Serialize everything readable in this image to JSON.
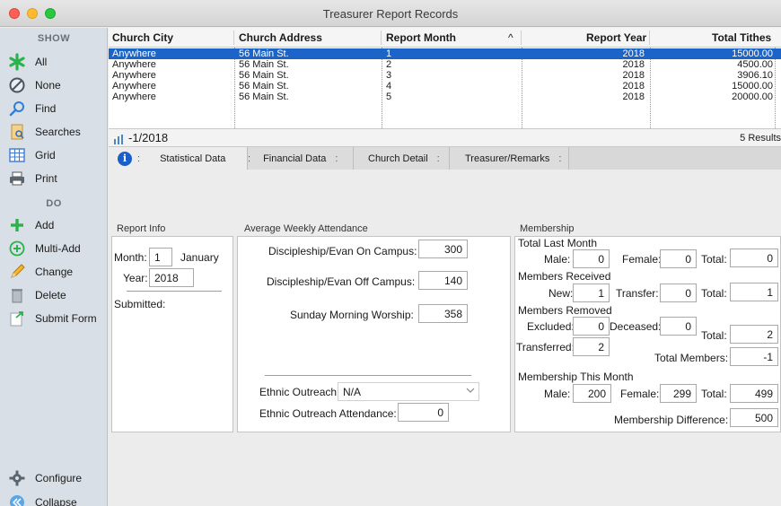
{
  "window": {
    "title": "Treasurer Report Records"
  },
  "sidebar": {
    "show_header": "SHOW",
    "do_header": "DO",
    "show_items": [
      {
        "label": "All",
        "icon": "asterisk-icon"
      },
      {
        "label": "None",
        "icon": "no-entry-icon"
      },
      {
        "label": "Find",
        "icon": "magnifier-icon"
      },
      {
        "label": "Searches",
        "icon": "saved-search-icon"
      },
      {
        "label": "Grid",
        "icon": "grid-icon"
      },
      {
        "label": "Print",
        "icon": "printer-icon"
      }
    ],
    "do_items": [
      {
        "label": "Add",
        "icon": "plus-icon"
      },
      {
        "label": "Multi-Add",
        "icon": "multi-add-icon"
      },
      {
        "label": "Change",
        "icon": "pencil-icon"
      },
      {
        "label": "Delete",
        "icon": "trash-icon"
      },
      {
        "label": "Submit Form",
        "icon": "document-arrow-icon"
      }
    ],
    "bottom_items": [
      {
        "label": "Configure",
        "icon": "gear-icon"
      },
      {
        "label": "Collapse",
        "icon": "collapse-icon"
      }
    ]
  },
  "table": {
    "columns": [
      "Church City",
      "Church Address",
      "Report Month",
      "Report Year",
      "Total Tithes"
    ],
    "sort_indicator": "^",
    "rows": [
      {
        "city": "Anywhere",
        "address": "56 Main St.",
        "month": "1",
        "year": "2018",
        "tithes": "15000.00"
      },
      {
        "city": "Anywhere",
        "address": "56 Main St.",
        "month": "2",
        "year": "2018",
        "tithes": "4500.00"
      },
      {
        "city": "Anywhere",
        "address": "56 Main St.",
        "month": "3",
        "year": "2018",
        "tithes": "3906.10"
      },
      {
        "city": "Anywhere",
        "address": "56 Main St.",
        "month": "4",
        "year": "2018",
        "tithes": "15000.00"
      },
      {
        "city": "Anywhere",
        "address": "56 Main St.",
        "month": "5",
        "year": "2018",
        "tithes": "20000.00"
      }
    ]
  },
  "status": {
    "record_label": "-1/2018",
    "results": "5 Results"
  },
  "tabs": [
    "Statistical Data",
    "Financial Data",
    "Church Detail",
    "Treasurer/Remarks"
  ],
  "tab_dots": ":",
  "info_glyph": "i",
  "report_info": {
    "title": "Report Info",
    "month_label": "Month:",
    "month_value": "1",
    "month_name": "January",
    "year_label": "Year:",
    "year_value": "2018",
    "submitted_label": "Submitted:"
  },
  "attendance": {
    "title": "Average Weekly Attendance",
    "on_campus_label": "Discipleship/Evan On Campus:",
    "on_campus_value": "300",
    "off_campus_label": "Discipleship/Evan Off Campus:",
    "off_campus_value": "140",
    "sunday_label": "Sunday Morning Worship:",
    "sunday_value": "358",
    "ethnic_label": "Ethnic Outreach",
    "ethnic_value": "N/A",
    "ethnic_attendance_label": "Ethnic Outreach Attendance:",
    "ethnic_attendance_value": "0"
  },
  "membership": {
    "title": "Membership",
    "total_last_month": "Total Last Month",
    "male_label": "Male:",
    "last_male": "0",
    "female_label": "Female:",
    "last_female": "0",
    "total_label": "Total:",
    "last_total": "0",
    "members_received": "Members Received",
    "new_label": "New:",
    "new_value": "1",
    "transfer_label": "Transfer:",
    "transfer_value": "0",
    "received_total": "1",
    "members_removed": "Members Removed",
    "excluded_label": "Excluded:",
    "excluded_value": "0",
    "deceased_label": "Deceased:",
    "deceased_value": "0",
    "removed_total": "2",
    "transferred_label": "Transferred:",
    "transferred_value": "2",
    "total_members_label": "Total Members:",
    "total_members_value": "-1",
    "this_month": "Membership This Month",
    "this_male": "200",
    "this_female": "299",
    "this_total": "499",
    "difference_label": "Membership Difference:",
    "difference_value": "500"
  },
  "colors": {
    "selection": "#1d64c8",
    "accent_green": "#2bb24c",
    "info_blue": "#1a5fc9"
  }
}
